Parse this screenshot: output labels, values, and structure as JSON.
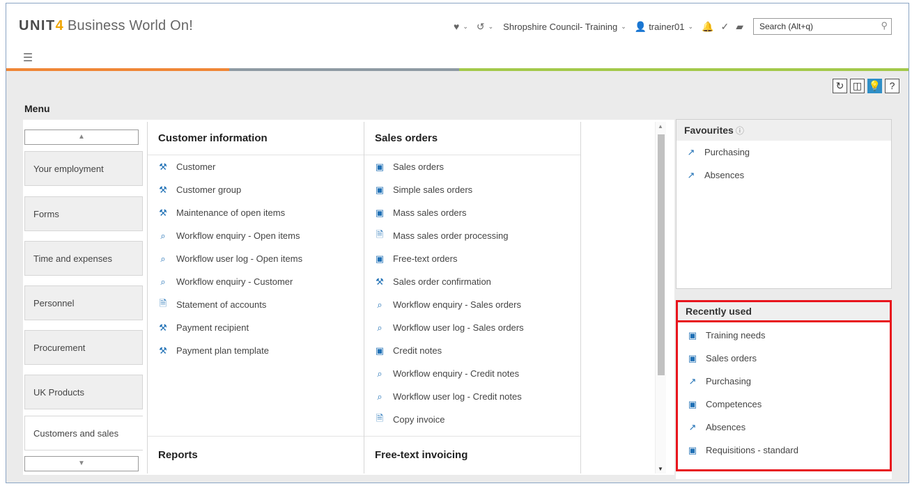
{
  "header": {
    "brand_unit": "UNIT",
    "brand_four": "4",
    "brand_rest": "Business World On!",
    "company": "Shropshire Council- Training",
    "user": "trainer01",
    "search_placeholder": "Search (Alt+q)"
  },
  "toolbar": {
    "refresh": "↻",
    "split": "◫",
    "help": "?"
  },
  "menu": {
    "title": "Menu",
    "categories": [
      {
        "label": "Your employment"
      },
      {
        "label": "Forms"
      },
      {
        "label": "Time and expenses"
      },
      {
        "label": "Personnel"
      },
      {
        "label": "Procurement"
      },
      {
        "label": "UK Products"
      },
      {
        "label": "Customers and sales"
      }
    ]
  },
  "columns": [
    {
      "heading": "Customer information",
      "footer": "Reports",
      "items": [
        {
          "label": "Customer",
          "icon": "tool-icon"
        },
        {
          "label": "Customer group",
          "icon": "tool-icon"
        },
        {
          "label": "Maintenance of open items",
          "icon": "tool-icon"
        },
        {
          "label": "Workflow enquiry - Open items",
          "icon": "search-doc-icon"
        },
        {
          "label": "Workflow user log - Open items",
          "icon": "search-doc-icon"
        },
        {
          "label": "Workflow enquiry - Customer",
          "icon": "search-doc-icon"
        },
        {
          "label": "Statement of accounts",
          "icon": "document-icon"
        },
        {
          "label": "Payment recipient",
          "icon": "tool-icon"
        },
        {
          "label": "Payment plan template",
          "icon": "tool-icon"
        }
      ]
    },
    {
      "heading": "Sales orders",
      "footer": "Free-text invoicing",
      "items": [
        {
          "label": "Sales orders",
          "icon": "form-icon"
        },
        {
          "label": "Simple sales orders",
          "icon": "form-icon"
        },
        {
          "label": "Mass sales orders",
          "icon": "form-icon"
        },
        {
          "label": "Mass sales order processing",
          "icon": "document-icon"
        },
        {
          "label": "Free-text orders",
          "icon": "form-icon"
        },
        {
          "label": "Sales order confirmation",
          "icon": "tools-icon"
        },
        {
          "label": "Workflow enquiry - Sales orders",
          "icon": "search-doc-icon"
        },
        {
          "label": "Workflow user log - Sales orders",
          "icon": "search-doc-icon"
        },
        {
          "label": "Credit notes",
          "icon": "form-icon"
        },
        {
          "label": "Workflow enquiry - Credit notes",
          "icon": "search-doc-icon"
        },
        {
          "label": "Workflow user log - Credit notes",
          "icon": "search-doc-icon"
        },
        {
          "label": "Copy invoice",
          "icon": "document-icon"
        }
      ]
    }
  ],
  "favourites": {
    "title": "Favourites",
    "items": [
      {
        "label": "Purchasing",
        "icon": "external-link-icon"
      },
      {
        "label": "Absences",
        "icon": "external-link-icon"
      }
    ]
  },
  "recent": {
    "title": "Recently used",
    "items": [
      {
        "label": "Training needs",
        "icon": "form-icon"
      },
      {
        "label": "Sales orders",
        "icon": "form-icon"
      },
      {
        "label": "Purchasing",
        "icon": "external-link-icon"
      },
      {
        "label": "Competences",
        "icon": "form-icon"
      },
      {
        "label": "Absences",
        "icon": "external-link-icon"
      },
      {
        "label": "Requisitions - standard",
        "icon": "form-icon"
      }
    ]
  }
}
